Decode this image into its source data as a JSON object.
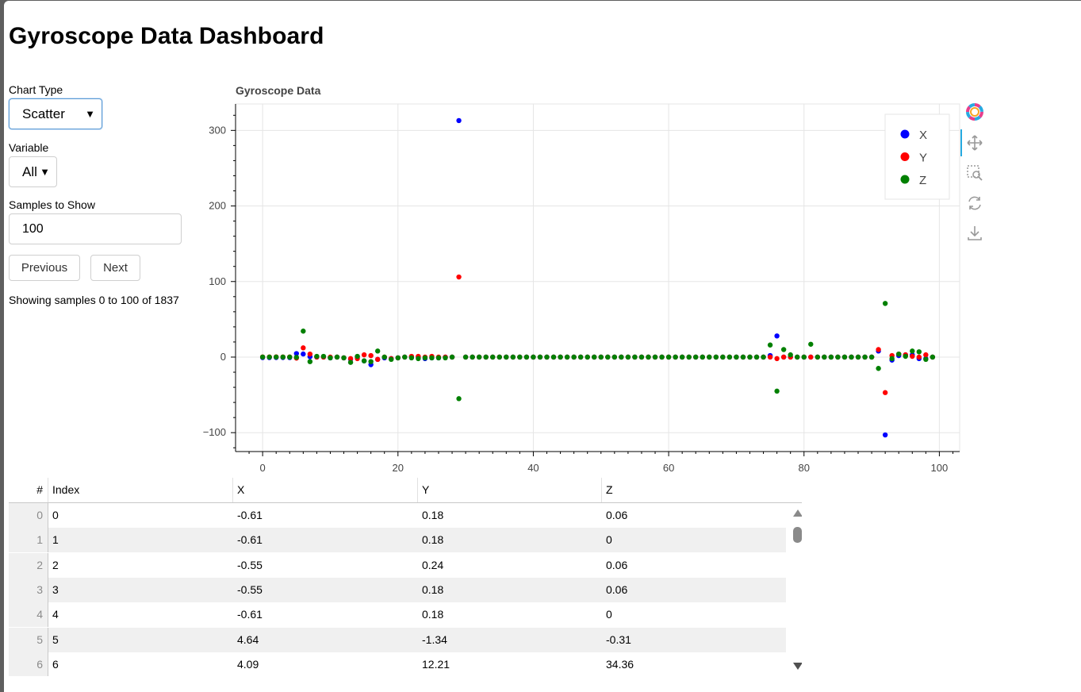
{
  "page": {
    "title": "Gyroscope Data Dashboard"
  },
  "controls": {
    "chart_type": {
      "label": "Chart Type",
      "value": "Scatter"
    },
    "variable": {
      "label": "Variable",
      "value": "All"
    },
    "samples": {
      "label": "Samples to Show",
      "value": "100"
    },
    "prev_label": "Previous",
    "next_label": "Next",
    "status": "Showing samples 0 to 100 of 1837"
  },
  "toolbar": {
    "tools": [
      "bokeh-logo-icon",
      "pan-icon",
      "box-zoom-icon",
      "reset-icon",
      "save-icon"
    ]
  },
  "chart_data": {
    "type": "scatter",
    "title": "Gyroscope Data",
    "xlabel": "",
    "ylabel": "",
    "xlim": [
      -4,
      103
    ],
    "ylim": [
      -125,
      335
    ],
    "xticks": [
      0,
      20,
      40,
      60,
      80,
      100
    ],
    "yticks": [
      -100,
      0,
      100,
      200,
      300
    ],
    "grid": true,
    "legend_position": "top-right",
    "x": [
      0,
      1,
      2,
      3,
      4,
      5,
      6,
      7,
      8,
      9,
      10,
      11,
      12,
      13,
      14,
      15,
      16,
      17,
      18,
      19,
      20,
      21,
      22,
      23,
      24,
      25,
      26,
      27,
      28,
      29,
      30,
      31,
      32,
      33,
      34,
      35,
      36,
      37,
      38,
      39,
      40,
      41,
      42,
      43,
      44,
      45,
      46,
      47,
      48,
      49,
      50,
      51,
      52,
      53,
      54,
      55,
      56,
      57,
      58,
      59,
      60,
      61,
      62,
      63,
      64,
      65,
      66,
      67,
      68,
      69,
      70,
      71,
      72,
      73,
      74,
      75,
      76,
      77,
      78,
      79,
      80,
      81,
      82,
      83,
      84,
      85,
      86,
      87,
      88,
      89,
      90,
      91,
      92,
      93,
      94,
      95,
      96,
      97,
      98,
      99
    ],
    "series": [
      {
        "name": "X",
        "color": "#0000ff",
        "values": [
          -0.61,
          -0.61,
          -0.55,
          -0.55,
          -0.61,
          4.64,
          4.09,
          0.5,
          0,
          0,
          -1,
          0,
          -1,
          -3,
          0,
          -5,
          -10,
          -3,
          -1,
          -2,
          -1,
          0,
          0,
          0,
          -2,
          -1,
          -1,
          0,
          0,
          313,
          0,
          0,
          0,
          0,
          0,
          0,
          0,
          0,
          0,
          0,
          0,
          0,
          0,
          0,
          0,
          0,
          0,
          0,
          0,
          0,
          0,
          0,
          0,
          0,
          0,
          0,
          0,
          0,
          0,
          0,
          0,
          0,
          0,
          0,
          0,
          0,
          0,
          0,
          0,
          0,
          0,
          0,
          0,
          0,
          0,
          2,
          28,
          0,
          0,
          0,
          0,
          0,
          0,
          0,
          0,
          0,
          0,
          0,
          0,
          0,
          0,
          8,
          -103,
          -4,
          2,
          3,
          3,
          -2,
          -2,
          0
        ]
      },
      {
        "name": "Y",
        "color": "#ff0000",
        "values": [
          0.18,
          0.18,
          0.24,
          0.18,
          0.18,
          -1.34,
          12.21,
          4,
          0,
          0,
          0,
          0,
          -1,
          -2,
          -2,
          3,
          2,
          -3,
          0,
          -2,
          -1,
          0,
          1,
          1,
          0,
          1,
          0,
          0,
          0,
          106,
          0,
          0,
          0,
          0,
          0,
          0,
          0,
          0,
          0,
          0,
          0,
          0,
          0,
          0,
          0,
          0,
          0,
          0,
          0,
          0,
          0,
          0,
          0,
          0,
          0,
          0,
          0,
          0,
          0,
          0,
          0,
          0,
          0,
          0,
          0,
          0,
          0,
          0,
          0,
          0,
          0,
          0,
          0,
          0,
          0,
          0,
          -2,
          0,
          0,
          0,
          0,
          0,
          0,
          0,
          0,
          0,
          0,
          0,
          0,
          0,
          0,
          10,
          -47,
          2,
          4,
          3,
          1,
          0,
          3,
          0
        ]
      },
      {
        "name": "Z",
        "color": "#008000",
        "values": [
          0.06,
          0,
          0.06,
          0.06,
          0,
          -0.31,
          34.36,
          -6,
          1,
          1,
          -1,
          0,
          -1,
          -7,
          1,
          -5,
          -6,
          8,
          0,
          -3,
          -1,
          0,
          -1,
          -2,
          -1,
          -1,
          -1,
          -1,
          0,
          -55,
          0,
          0,
          0,
          0,
          0,
          0,
          0,
          0,
          0,
          0,
          0,
          0,
          0,
          0,
          0,
          0,
          0,
          0,
          0,
          0,
          0,
          0,
          0,
          0,
          0,
          0,
          0,
          0,
          0,
          0,
          0,
          0,
          0,
          0,
          0,
          0,
          0,
          0,
          0,
          0,
          0,
          0,
          0,
          0,
          0,
          16,
          -45,
          10,
          3,
          0,
          0,
          17,
          0,
          0,
          0,
          0,
          0,
          0,
          0,
          0,
          0,
          -15,
          71,
          -2,
          4,
          1,
          8,
          7,
          -3,
          0
        ]
      }
    ]
  },
  "table": {
    "columns": [
      "#",
      "Index",
      "X",
      "Y",
      "Z"
    ],
    "rows": [
      [
        "0",
        "0",
        "-0.61",
        "0.18",
        "0.06"
      ],
      [
        "1",
        "1",
        "-0.61",
        "0.18",
        "0"
      ],
      [
        "2",
        "2",
        "-0.55",
        "0.24",
        "0.06"
      ],
      [
        "3",
        "3",
        "-0.55",
        "0.18",
        "0.06"
      ],
      [
        "4",
        "4",
        "-0.61",
        "0.18",
        "0"
      ],
      [
        "5",
        "5",
        "4.64",
        "-1.34",
        "-0.31"
      ],
      [
        "6",
        "6",
        "4.09",
        "12.21",
        "34.36"
      ]
    ]
  }
}
